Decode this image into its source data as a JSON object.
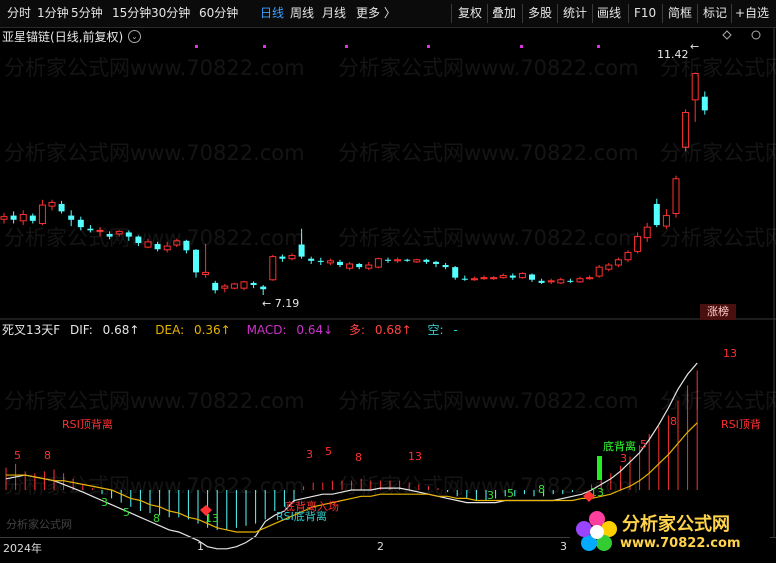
{
  "toolbar": {
    "left": [
      "分时",
      "1分钟",
      "5分钟",
      "15分钟",
      "30分钟",
      "60分钟",
      "日线",
      "周线",
      "月线",
      "更多 〉"
    ],
    "active_index": 6,
    "right": [
      "复权",
      "叠加",
      "多股",
      "统计",
      "画线",
      "F10",
      "简框",
      "标记",
      "+自选"
    ]
  },
  "header": {
    "name": "亚星锚链",
    "mode": "(日线,前复权)",
    "dropdown": "⌄"
  },
  "price_labels": {
    "high": "11.42",
    "low": "← 7.19",
    "arrow_high": "←"
  },
  "indicator": {
    "name": "死叉13天F",
    "dif_label": "DIF:",
    "dif_value": "0.68↑",
    "dea_label": "DEA:",
    "dea_value": "0.36↑",
    "macd_label": "MACD:",
    "macd_value": "0.64↓",
    "duo_label": "多:",
    "duo_value": "0.68↑",
    "kong_label": "空:",
    "kong_value": "-"
  },
  "annotations": {
    "rsi_top_left": "RSI顶背离",
    "rsi_top_right": "RSI顶背",
    "rsi_bottom": "RSI底背离",
    "bottom_divergence": "底背离",
    "death_cross": "底背离入场"
  },
  "counts": {
    "green_1": [
      "3",
      "5",
      "8",
      "13"
    ],
    "red_1": [
      "3",
      "5",
      "8",
      "13"
    ],
    "green_2": [
      "3",
      "5",
      "8",
      "13"
    ],
    "red_2": [
      "3",
      "5",
      "8",
      "13"
    ],
    "red_left": [
      "5",
      "8"
    ]
  },
  "xaxis": {
    "labels": [
      "2024年",
      "1",
      "2",
      "3"
    ]
  },
  "badge": "涨榜",
  "watermark": "分析家公式网www.70822.com",
  "watermark_small": "分析家公式网",
  "logo": {
    "title": "分析家公式网",
    "url": "www.70822.com"
  },
  "chart_data": {
    "type": "candlestick",
    "price_range": [
      7.0,
      12.0
    ],
    "candles": [
      {
        "o": 8.63,
        "c": 8.68,
        "h": 8.75,
        "l": 8.55
      },
      {
        "o": 8.7,
        "c": 8.62,
        "h": 8.78,
        "l": 8.55
      },
      {
        "o": 8.6,
        "c": 8.72,
        "h": 8.8,
        "l": 8.52
      },
      {
        "o": 8.7,
        "c": 8.6,
        "h": 8.74,
        "l": 8.55
      },
      {
        "o": 8.55,
        "c": 8.9,
        "h": 9.0,
        "l": 8.52
      },
      {
        "o": 8.88,
        "c": 8.95,
        "h": 9.0,
        "l": 8.8
      },
      {
        "o": 8.92,
        "c": 8.78,
        "h": 8.98,
        "l": 8.74
      },
      {
        "o": 8.7,
        "c": 8.62,
        "h": 8.8,
        "l": 8.5
      },
      {
        "o": 8.62,
        "c": 8.48,
        "h": 8.68,
        "l": 8.42
      },
      {
        "o": 8.45,
        "c": 8.42,
        "h": 8.52,
        "l": 8.38
      },
      {
        "o": 8.42,
        "c": 8.42,
        "h": 8.48,
        "l": 8.3
      },
      {
        "o": 8.35,
        "c": 8.3,
        "h": 8.4,
        "l": 8.25
      },
      {
        "o": 8.35,
        "c": 8.4,
        "h": 8.42,
        "l": 8.3
      },
      {
        "o": 8.38,
        "c": 8.3,
        "h": 8.42,
        "l": 8.22
      },
      {
        "o": 8.3,
        "c": 8.18,
        "h": 8.32,
        "l": 8.12
      },
      {
        "o": 8.1,
        "c": 8.2,
        "h": 8.26,
        "l": 8.08
      },
      {
        "o": 8.16,
        "c": 8.06,
        "h": 8.2,
        "l": 8.02
      },
      {
        "o": 8.05,
        "c": 8.12,
        "h": 8.2,
        "l": 8.0
      },
      {
        "o": 8.14,
        "c": 8.22,
        "h": 8.26,
        "l": 8.1
      },
      {
        "o": 8.22,
        "c": 8.04,
        "h": 8.24,
        "l": 7.98
      },
      {
        "o": 8.05,
        "c": 7.62,
        "h": 8.06,
        "l": 7.52
      },
      {
        "o": 7.58,
        "c": 7.62,
        "h": 8.16,
        "l": 7.52
      },
      {
        "o": 7.42,
        "c": 7.28,
        "h": 7.46,
        "l": 7.22
      },
      {
        "o": 7.32,
        "c": 7.36,
        "h": 7.4,
        "l": 7.24
      },
      {
        "o": 7.32,
        "c": 7.4,
        "h": 7.42,
        "l": 7.3
      },
      {
        "o": 7.32,
        "c": 7.44,
        "h": 7.46,
        "l": 7.28
      },
      {
        "o": 7.42,
        "c": 7.38,
        "h": 7.45,
        "l": 7.32
      },
      {
        "o": 7.35,
        "c": 7.3,
        "h": 7.38,
        "l": 7.19
      },
      {
        "o": 7.48,
        "c": 7.92,
        "h": 7.95,
        "l": 7.46
      },
      {
        "o": 7.92,
        "c": 7.88,
        "h": 7.96,
        "l": 7.82
      },
      {
        "o": 7.88,
        "c": 7.94,
        "h": 7.98,
        "l": 7.85
      },
      {
        "o": 8.15,
        "c": 7.92,
        "h": 8.45,
        "l": 7.88
      },
      {
        "o": 7.88,
        "c": 7.84,
        "h": 7.92,
        "l": 7.78
      },
      {
        "o": 7.84,
        "c": 7.82,
        "h": 7.9,
        "l": 7.76
      },
      {
        "o": 7.8,
        "c": 7.84,
        "h": 7.88,
        "l": 7.76
      },
      {
        "o": 7.82,
        "c": 7.76,
        "h": 7.86,
        "l": 7.72
      },
      {
        "o": 7.7,
        "c": 7.78,
        "h": 7.82,
        "l": 7.66
      },
      {
        "o": 7.78,
        "c": 7.72,
        "h": 7.8,
        "l": 7.68
      },
      {
        "o": 7.7,
        "c": 7.76,
        "h": 7.82,
        "l": 7.66
      },
      {
        "o": 7.72,
        "c": 7.88,
        "h": 7.9,
        "l": 7.7
      },
      {
        "o": 7.86,
        "c": 7.84,
        "h": 7.9,
        "l": 7.8
      },
      {
        "o": 7.84,
        "c": 7.86,
        "h": 7.9,
        "l": 7.8
      },
      {
        "o": 7.86,
        "c": 7.84,
        "h": 7.88,
        "l": 7.82
      },
      {
        "o": 7.82,
        "c": 7.86,
        "h": 7.88,
        "l": 7.8
      },
      {
        "o": 7.86,
        "c": 7.82,
        "h": 7.88,
        "l": 7.78
      },
      {
        "o": 7.82,
        "c": 7.78,
        "h": 7.84,
        "l": 7.72
      },
      {
        "o": 7.76,
        "c": 7.72,
        "h": 7.8,
        "l": 7.68
      },
      {
        "o": 7.72,
        "c": 7.52,
        "h": 7.74,
        "l": 7.48
      },
      {
        "o": 7.5,
        "c": 7.48,
        "h": 7.56,
        "l": 7.46
      },
      {
        "o": 7.48,
        "c": 7.5,
        "h": 7.54,
        "l": 7.46
      },
      {
        "o": 7.5,
        "c": 7.52,
        "h": 7.56,
        "l": 7.48
      },
      {
        "o": 7.5,
        "c": 7.52,
        "h": 7.55,
        "l": 7.48
      },
      {
        "o": 7.52,
        "c": 7.56,
        "h": 7.6,
        "l": 7.5
      },
      {
        "o": 7.56,
        "c": 7.52,
        "h": 7.6,
        "l": 7.48
      },
      {
        "o": 7.52,
        "c": 7.6,
        "h": 7.62,
        "l": 7.5
      },
      {
        "o": 7.58,
        "c": 7.48,
        "h": 7.6,
        "l": 7.44
      },
      {
        "o": 7.46,
        "c": 7.42,
        "h": 7.5,
        "l": 7.4
      },
      {
        "o": 7.44,
        "c": 7.46,
        "h": 7.5,
        "l": 7.4
      },
      {
        "o": 7.42,
        "c": 7.48,
        "h": 7.52,
        "l": 7.4
      },
      {
        "o": 7.46,
        "c": 7.44,
        "h": 7.5,
        "l": 7.42
      },
      {
        "o": 7.44,
        "c": 7.5,
        "h": 7.54,
        "l": 7.42
      },
      {
        "o": 7.5,
        "c": 7.52,
        "h": 7.56,
        "l": 7.48
      },
      {
        "o": 7.55,
        "c": 7.72,
        "h": 7.76,
        "l": 7.52
      },
      {
        "o": 7.68,
        "c": 7.76,
        "h": 7.8,
        "l": 7.64
      },
      {
        "o": 7.76,
        "c": 7.86,
        "h": 7.9,
        "l": 7.72
      },
      {
        "o": 7.86,
        "c": 8.0,
        "h": 8.04,
        "l": 7.82
      },
      {
        "o": 8.02,
        "c": 8.3,
        "h": 8.38,
        "l": 7.98
      },
      {
        "o": 8.28,
        "c": 8.48,
        "h": 8.56,
        "l": 8.2
      },
      {
        "o": 8.92,
        "c": 8.52,
        "h": 9.02,
        "l": 8.48
      },
      {
        "o": 8.5,
        "c": 8.7,
        "h": 8.82,
        "l": 8.45
      },
      {
        "o": 8.74,
        "c": 9.4,
        "h": 9.46,
        "l": 8.66
      },
      {
        "o": 10.0,
        "c": 10.66,
        "h": 10.72,
        "l": 9.92
      },
      {
        "o": 10.9,
        "c": 11.4,
        "h": 11.42,
        "l": 10.48
      },
      {
        "o": 10.96,
        "c": 10.7,
        "h": 11.06,
        "l": 10.62
      }
    ],
    "macd": {
      "hist": [
        0.12,
        0.14,
        0.1,
        0.09,
        0.1,
        0.11,
        0.09,
        0.06,
        0.03,
        0.01,
        -0.02,
        -0.04,
        -0.06,
        -0.08,
        -0.1,
        -0.11,
        -0.12,
        -0.13,
        -0.13,
        -0.14,
        -0.16,
        -0.18,
        -0.19,
        -0.19,
        -0.18,
        -0.17,
        -0.16,
        -0.14,
        -0.1,
        -0.08,
        -0.06,
        0.02,
        0.04,
        0.04,
        0.05,
        0.05,
        0.05,
        0.06,
        0.05,
        0.05,
        0.05,
        0.05,
        0.04,
        0.03,
        0.02,
        0.01,
        -0.01,
        -0.03,
        -0.04,
        -0.05,
        -0.05,
        -0.04,
        -0.03,
        -0.03,
        -0.02,
        -0.03,
        -0.03,
        -0.02,
        -0.02,
        -0.01,
        0.0,
        0.03,
        0.06,
        0.09,
        0.13,
        0.18,
        0.24,
        0.3,
        0.34,
        0.4,
        0.48,
        0.56,
        0.64
      ],
      "dif": [
        0.06,
        0.07,
        0.08,
        0.07,
        0.06,
        0.05,
        0.03,
        0.01,
        -0.01,
        -0.03,
        -0.05,
        -0.07,
        -0.09,
        -0.11,
        -0.13,
        -0.15,
        -0.17,
        -0.19,
        -0.2,
        -0.22,
        -0.24,
        -0.27,
        -0.28,
        -0.28,
        -0.27,
        -0.25,
        -0.22,
        -0.15,
        -0.12,
        -0.1,
        -0.05,
        -0.04,
        -0.03,
        -0.02,
        -0.02,
        -0.01,
        0.0,
        0.0,
        0.0,
        0.01,
        0.01,
        0.01,
        0.0,
        -0.01,
        -0.02,
        -0.03,
        -0.04,
        -0.05,
        -0.06,
        -0.06,
        -0.06,
        -0.06,
        -0.05,
        -0.05,
        -0.05,
        -0.05,
        -0.05,
        -0.05,
        -0.04,
        -0.03,
        -0.02,
        0.0,
        0.03,
        0.06,
        0.1,
        0.15,
        0.2,
        0.27,
        0.35,
        0.44,
        0.54,
        0.62,
        0.68
      ],
      "dea": [
        0.08,
        0.08,
        0.08,
        0.07,
        0.06,
        0.05,
        0.05,
        0.04,
        0.03,
        0.02,
        0.01,
        0.0,
        -0.02,
        -0.04,
        -0.05,
        -0.07,
        -0.08,
        -0.1,
        -0.11,
        -0.13,
        -0.14,
        -0.16,
        -0.18,
        -0.19,
        -0.2,
        -0.2,
        -0.2,
        -0.18,
        -0.16,
        -0.14,
        -0.12,
        -0.1,
        -0.08,
        -0.07,
        -0.06,
        -0.05,
        -0.04,
        -0.03,
        -0.03,
        -0.02,
        -0.02,
        -0.02,
        -0.02,
        -0.02,
        -0.02,
        -0.03,
        -0.03,
        -0.04,
        -0.04,
        -0.05,
        -0.05,
        -0.05,
        -0.05,
        -0.05,
        -0.05,
        -0.05,
        -0.05,
        -0.05,
        -0.05,
        -0.05,
        -0.04,
        -0.04,
        -0.03,
        -0.02,
        0.0,
        0.02,
        0.05,
        0.09,
        0.14,
        0.19,
        0.25,
        0.31,
        0.36
      ],
      "range": [
        -0.3,
        0.75
      ]
    }
  }
}
